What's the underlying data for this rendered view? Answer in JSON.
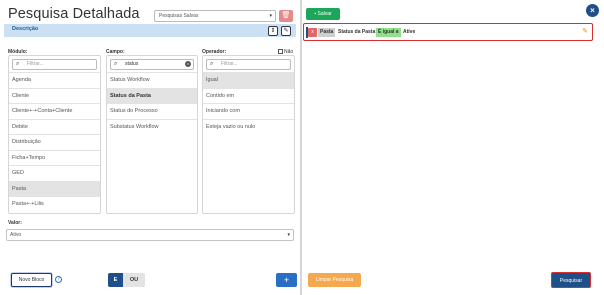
{
  "header": {
    "title": "Pesquisa Detalhada",
    "saved_searches_select": "Pesquisas Salvas",
    "description_label": "Descrição"
  },
  "columns": {
    "modulo": {
      "label": "Módulo:",
      "filter_placeholder": "Filtrar...",
      "items": [
        "Agenda",
        "Cliente",
        "Cliente+-+Conta+Cliente",
        "Debite",
        "Distribuição",
        "Ficha+Tempo",
        "GED",
        "Pasta",
        "Pasta+-+Lilis"
      ],
      "selected": "Pasta"
    },
    "campo": {
      "label": "Campo:",
      "filter_value": "status",
      "items": [
        "Status Workflow",
        "Status da Pasta",
        "Status do Processo",
        "Substatus Workflow"
      ],
      "selected": "Status da Pasta"
    },
    "operador": {
      "label": "Operador:",
      "not_label": "Não",
      "filter_placeholder": "Filtrar...",
      "items": [
        "Igual",
        "Contido em",
        "Iniciando com",
        "Esteja vazio ou nulo"
      ],
      "selected": "Igual"
    }
  },
  "valor": {
    "label": "Valor:",
    "selected": "Ativo"
  },
  "footer_left": {
    "new_block": "Novo Bloco",
    "help": "?",
    "and_label": "E",
    "or_label": "OU",
    "add": "+"
  },
  "right_panel": {
    "save": "Salvar",
    "close": "×",
    "criterion": {
      "remove": "x",
      "module": "Pasta",
      "field": "Status da Pasta",
      "operator": "É igual a",
      "value": "Ative",
      "edit": "✎"
    },
    "clear": "Limpar Pesquisa",
    "search": "Pesquisar"
  },
  "colors": {
    "primary": "#1f4f88",
    "success": "#1ca65a",
    "danger": "#e46767",
    "warning": "#f5a94f",
    "highlight_border": "#d62f2f",
    "description_bar": "#cbe1f3",
    "operator_tag": "#8fe08a"
  }
}
